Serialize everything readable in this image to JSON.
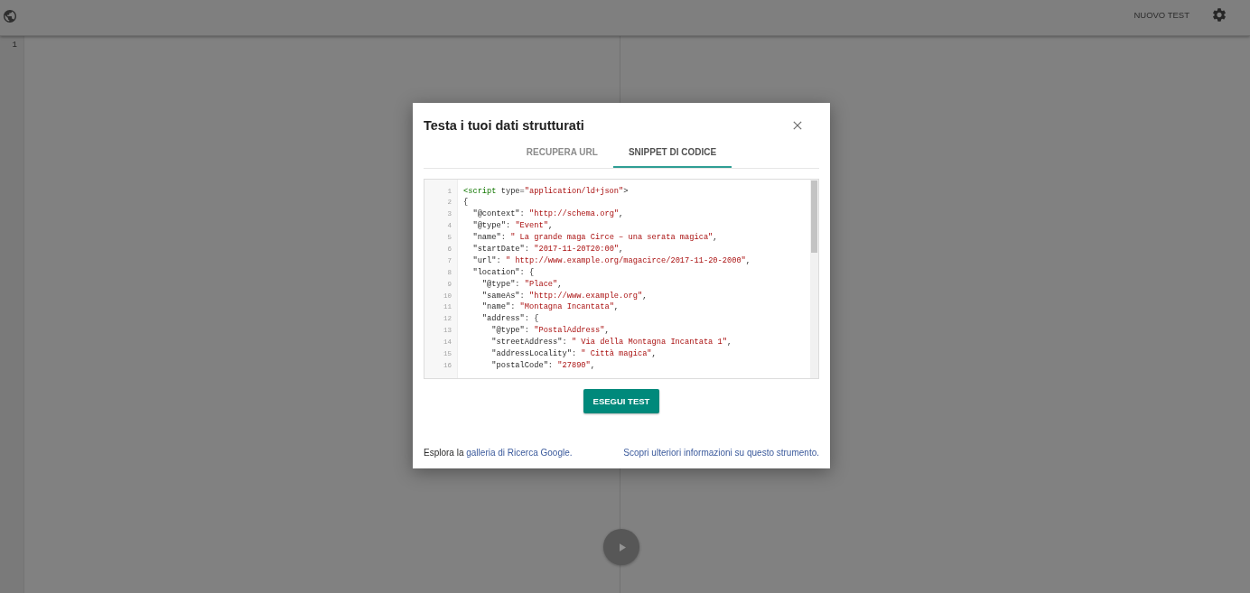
{
  "top_bar": {
    "new_test_button": "NUOVO TEST"
  },
  "editor": {
    "line_numbers": [
      "1"
    ]
  },
  "dialog": {
    "title": "Testa i tuoi dati strutturati",
    "tabs": [
      {
        "label": "RECUPERA URL",
        "selected": false
      },
      {
        "label": "SNIPPET DI CODICE",
        "selected": true
      }
    ],
    "code_lines": [
      {
        "number": "1",
        "text": "<script type=\"application/ld+json\">"
      },
      {
        "number": "2",
        "text": "{"
      },
      {
        "number": "3",
        "text": "  \"@context\": \"http://schema.org\","
      },
      {
        "number": "4",
        "text": "  \"@type\": \"Event\","
      },
      {
        "number": "5",
        "text": "  \"name\": \" La grande maga Circe – una serata magica\","
      },
      {
        "number": "6",
        "text": "  \"startDate\": \"2017-11-20T20:00\","
      },
      {
        "number": "7",
        "text": "  \"url\": \" http://www.example.org/magacirce/2017-11-20-2000\","
      },
      {
        "number": "8",
        "text": "  \"location\": {"
      },
      {
        "number": "9",
        "text": "    \"@type\": \"Place\","
      },
      {
        "number": "10",
        "text": "    \"sameAs\": \"http://www.example.org\","
      },
      {
        "number": "11",
        "text": "    \"name\": \"Montagna Incantata\","
      },
      {
        "number": "12",
        "text": "    \"address\": {"
      },
      {
        "number": "13",
        "text": "      \"@type\": \"PostalAddress\","
      },
      {
        "number": "14",
        "text": "      \"streetAddress\": \" Via della Montagna Incantata 1\","
      },
      {
        "number": "15",
        "text": "      \"addressLocality\": \" Città magica\","
      },
      {
        "number": "16",
        "text": "      \"postalCode\": \"27890\","
      }
    ],
    "run_button": "ESEGUI TEST",
    "footer": {
      "gallery_sentence": {
        "text": "Esplora la ",
        "link": "galleria di Ricerca Google."
      },
      "info_link": "Scopri ulteriori informazioni su questo strumento."
    }
  }
}
